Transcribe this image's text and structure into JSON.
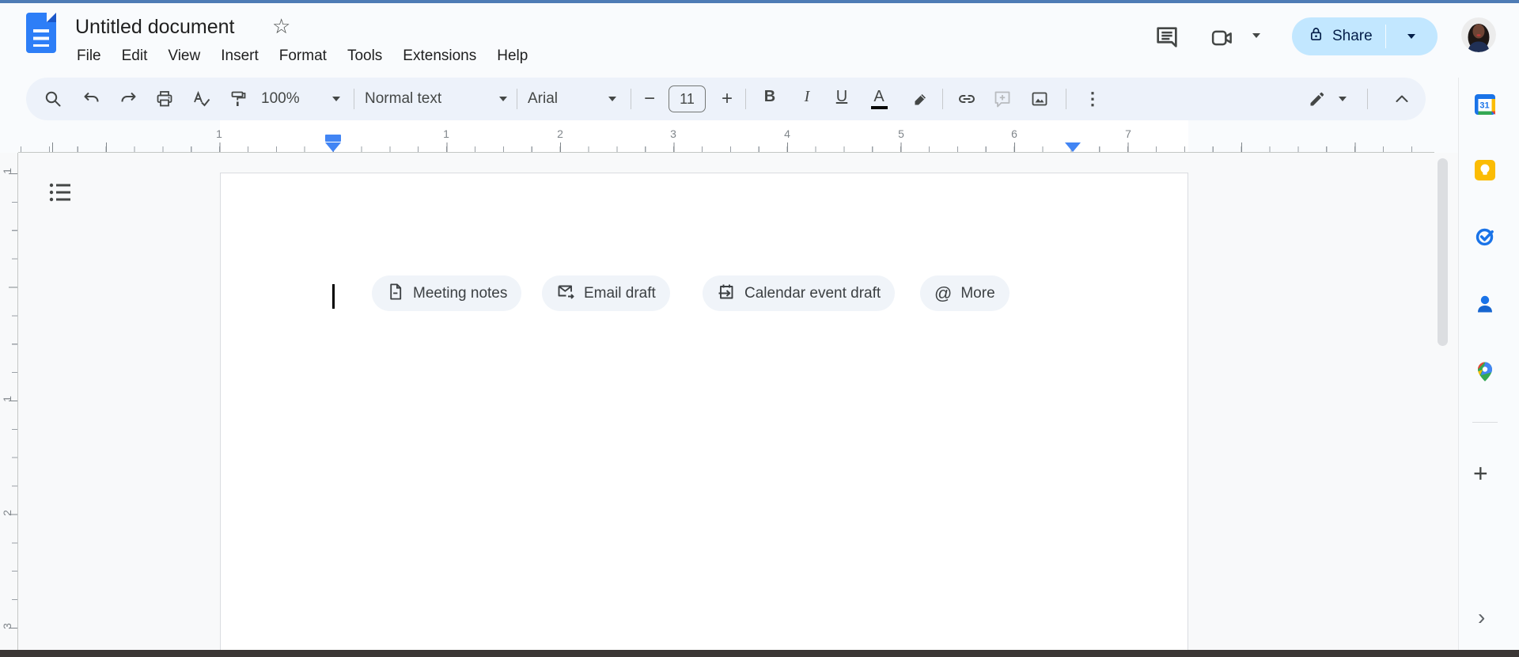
{
  "header": {
    "title": "Untitled document",
    "menus": [
      "File",
      "Edit",
      "View",
      "Insert",
      "Format",
      "Tools",
      "Extensions",
      "Help"
    ],
    "share_label": "Share"
  },
  "toolbar": {
    "zoom_value": "100%",
    "style_value": "Normal text",
    "font_value": "Arial",
    "font_size_value": "11",
    "bold_label": "B",
    "italic_label": "I",
    "underline_label": "U",
    "text_color_label": "A"
  },
  "ruler": {
    "horizontal_numbers": [
      "1",
      "1",
      "2",
      "3",
      "4",
      "5",
      "6",
      "7"
    ],
    "vertical_numbers": [
      "1",
      "1",
      "2",
      "3"
    ]
  },
  "document": {
    "chips": [
      {
        "label": "Meeting notes"
      },
      {
        "label": "Email draft"
      },
      {
        "label": "Calendar event draft"
      },
      {
        "label": "More"
      }
    ]
  },
  "sidebar": {
    "calendar_day": "31",
    "items": [
      "calendar",
      "keep",
      "tasks",
      "contacts",
      "maps"
    ]
  },
  "icons": {
    "star": "☆",
    "more_vertical": "⋮",
    "minus": "−",
    "plus": "+",
    "at": "@",
    "add": "+",
    "chevron_right": "›"
  },
  "colors": {
    "accent_blue": "#4285f4",
    "share_bg": "#c2e7ff",
    "share_text": "#041e49",
    "toolbar_bg": "#edf2fa",
    "chip_bg": "#f0f4f9",
    "icon_gray": "#444746"
  }
}
